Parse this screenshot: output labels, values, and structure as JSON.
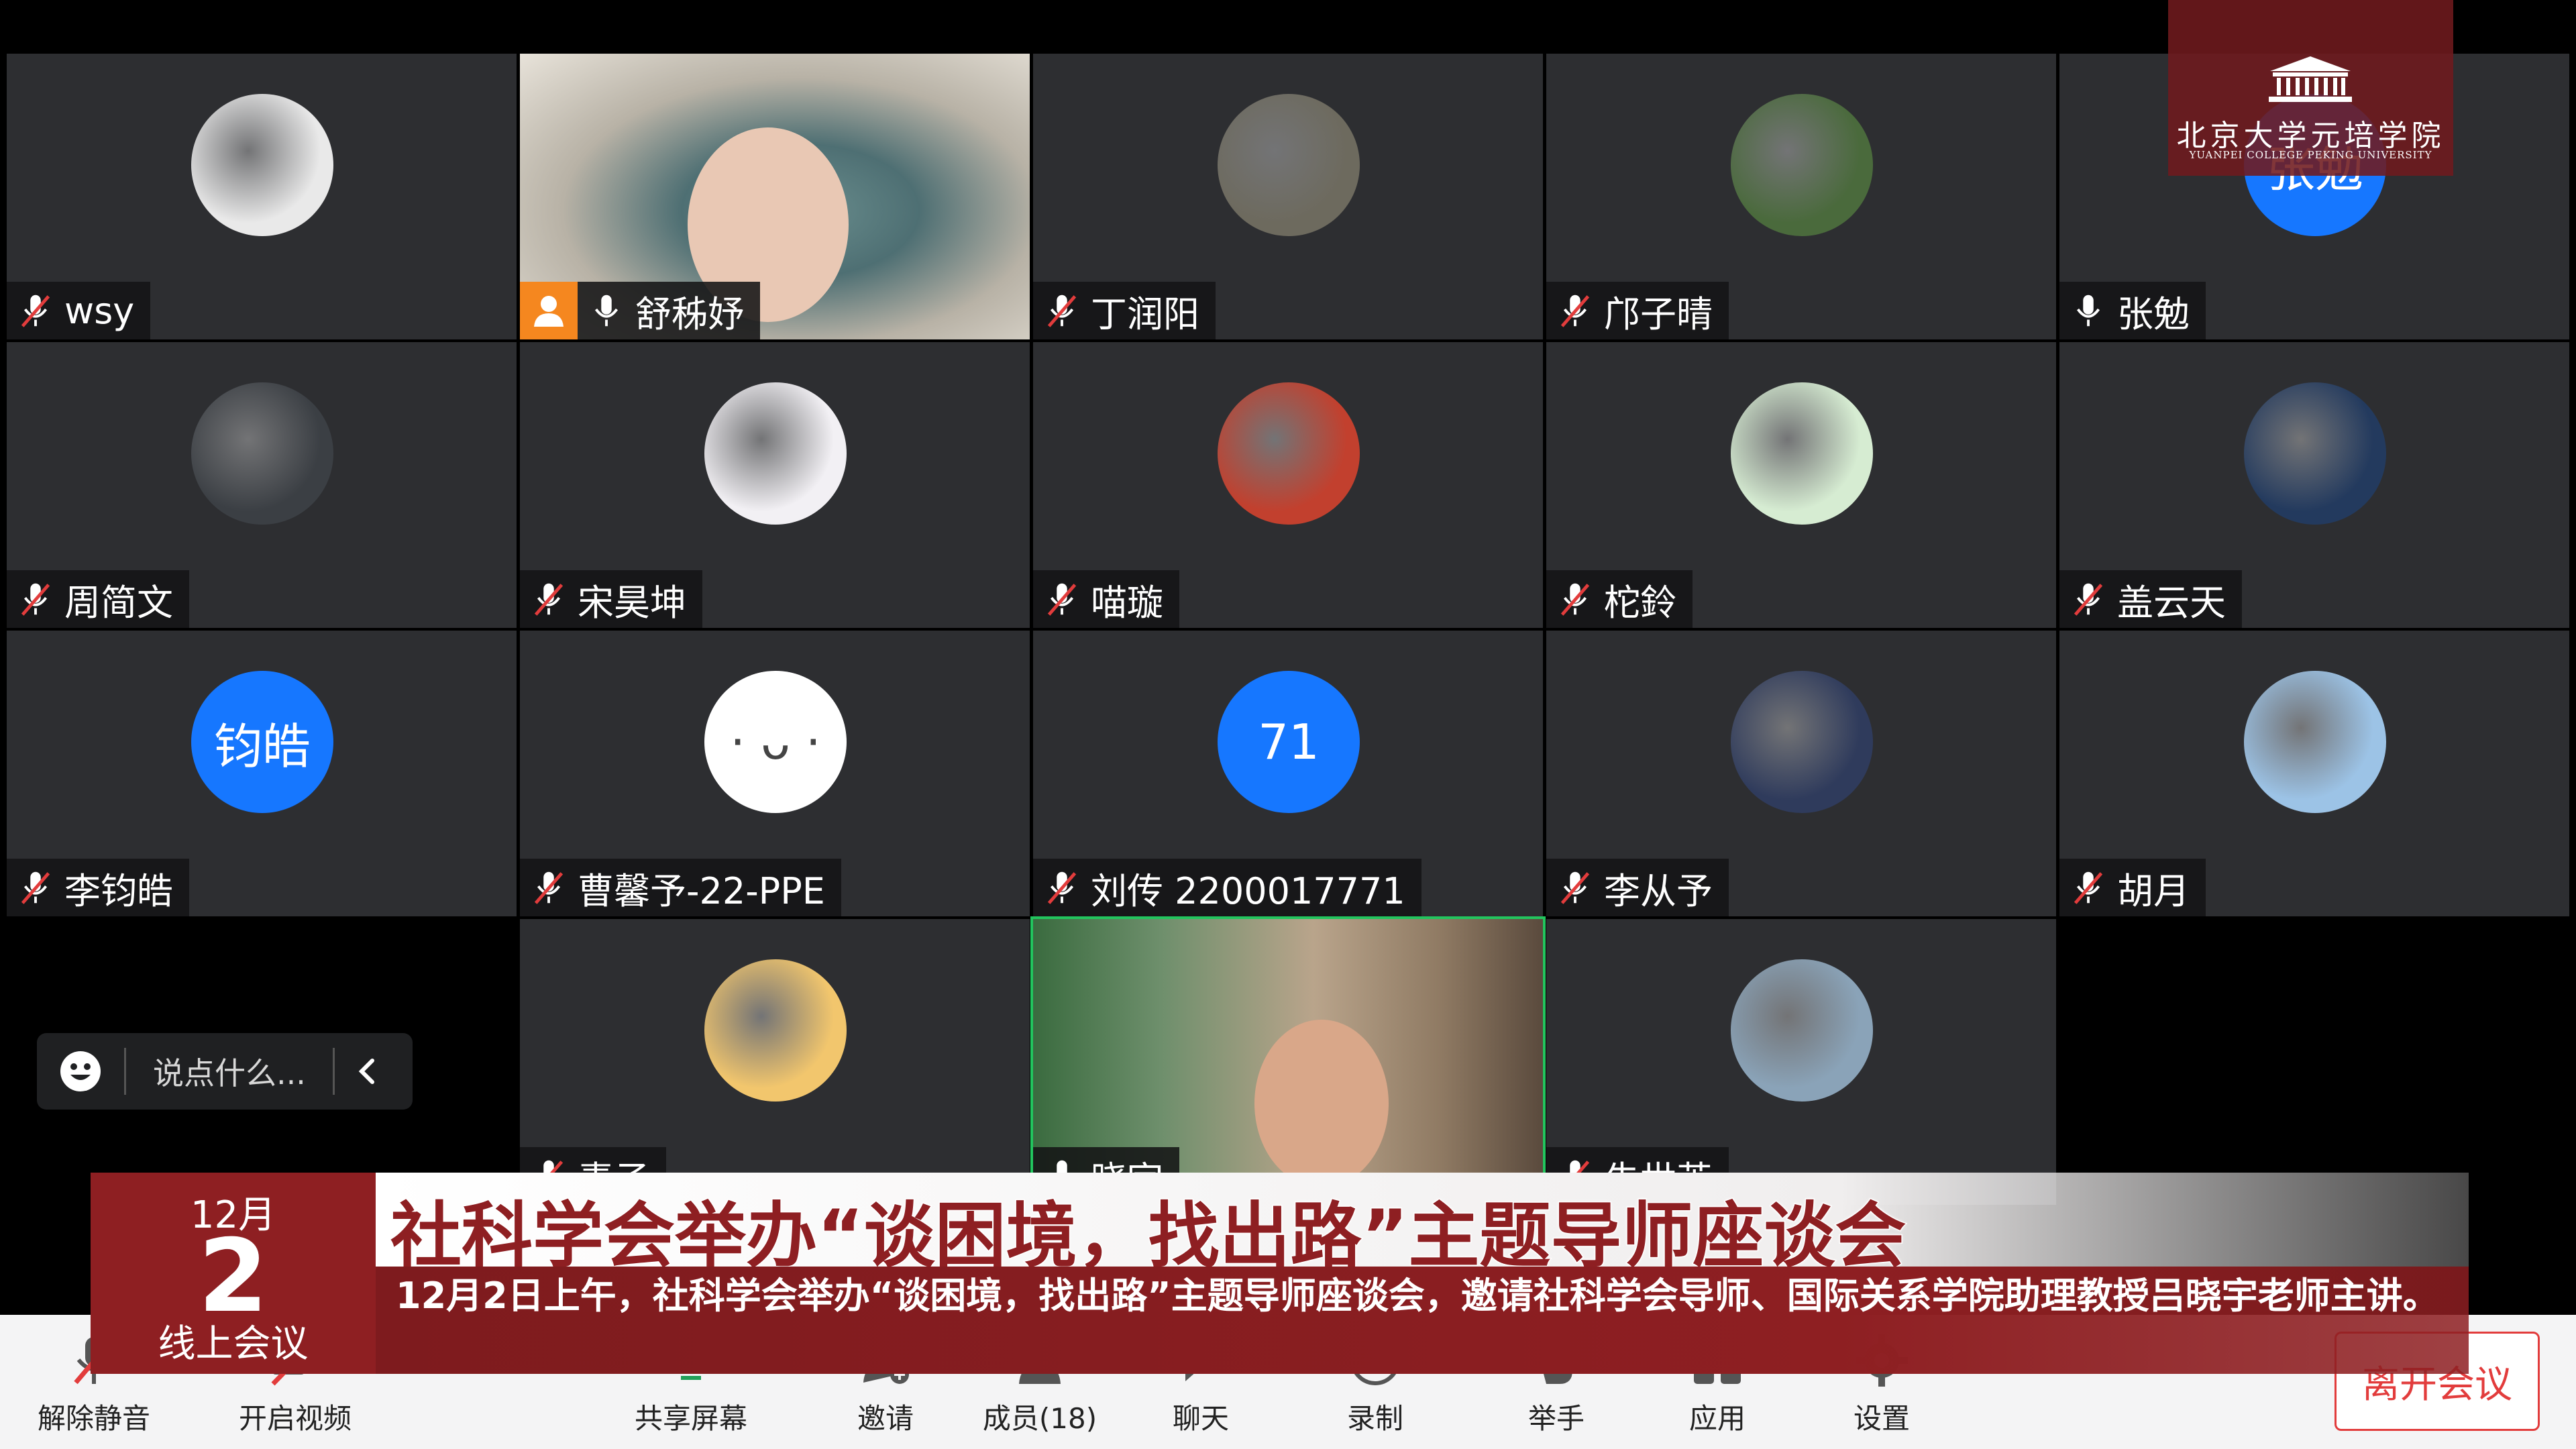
{
  "logo": {
    "name_cn": "北京大学元培学院",
    "name_en": "YUANPEI COLLEGE PEKING UNIVERSITY"
  },
  "participants": [
    {
      "name": "wsy",
      "mic": "muted",
      "avatar": "photo",
      "avatar_color": "#e9e9e9"
    },
    {
      "name": "舒秭妤",
      "mic": "on",
      "avatar": "video",
      "host": true
    },
    {
      "name": "丁润阳",
      "mic": "muted",
      "avatar": "photo",
      "avatar_color": "#6d6a5e"
    },
    {
      "name": "邝子晴",
      "mic": "muted",
      "avatar": "photo",
      "avatar_color": "#4a6a3c"
    },
    {
      "name": "张勉",
      "mic": "on",
      "avatar": "initials",
      "initials": "张勉",
      "avatar_color": "#1677ff"
    },
    {
      "name": "周简文",
      "mic": "muted",
      "avatar": "photo",
      "avatar_color": "#3b3f44"
    },
    {
      "name": "宋昊坤",
      "mic": "muted",
      "avatar": "photo",
      "avatar_color": "#f2f0f4"
    },
    {
      "name": "喵璇",
      "mic": "muted",
      "avatar": "photo",
      "avatar_color": "#c2402e"
    },
    {
      "name": "柁鈴",
      "mic": "muted",
      "avatar": "photo",
      "avatar_color": "#d6ecd2"
    },
    {
      "name": "盖云天",
      "mic": "muted",
      "avatar": "photo",
      "avatar_color": "#233a5e"
    },
    {
      "name": "李钧皓",
      "mic": "muted",
      "avatar": "initials",
      "initials": "钧皓",
      "avatar_color": "#1677ff"
    },
    {
      "name": "曹馨予-22-PPE",
      "mic": "muted",
      "avatar": "initials",
      "initials": "· ᴗ ·",
      "avatar_color": "#ffffff"
    },
    {
      "name": "刘传 2200017771",
      "mic": "muted",
      "avatar": "initials",
      "initials": "71",
      "avatar_color": "#1677ff"
    },
    {
      "name": "李从予",
      "mic": "muted",
      "avatar": "photo",
      "avatar_color": "#2f3b5c"
    },
    {
      "name": "胡月",
      "mic": "muted",
      "avatar": "photo",
      "avatar_color": "#9cc3e6"
    },
    {
      "name": "",
      "mic": "none",
      "avatar": "empty"
    },
    {
      "name": "素子",
      "mic": "muted",
      "avatar": "photo",
      "avatar_color": "#f2c66d"
    },
    {
      "name": "晓宇",
      "mic": "on",
      "avatar": "video"
    },
    {
      "name": "朱世英",
      "mic": "muted",
      "avatar": "photo",
      "avatar_color": "#8aa3b8"
    }
  ],
  "chat_input": {
    "placeholder": "说点什么..."
  },
  "lower_third": {
    "month": "12月",
    "day": "2",
    "tag": "线上会议",
    "headline": "社科学会举办“谈困境，找出路”主题导师座谈会",
    "body": "12月2日上午，社科学会举办“谈困境，找出路”主题导师座谈会，邀请社科学会导师、国际关系学院助理教授吕晓宇老师主讲。"
  },
  "toolbar": {
    "unmute": "解除静音",
    "start_video": "开启视频",
    "share_screen": "共享屏幕",
    "invite": "邀请",
    "members": "成员(18)",
    "chat": "聊天",
    "record": "录制",
    "raise_hand": "举手",
    "apps": "应用",
    "settings": "设置",
    "leave": "离开会议"
  }
}
